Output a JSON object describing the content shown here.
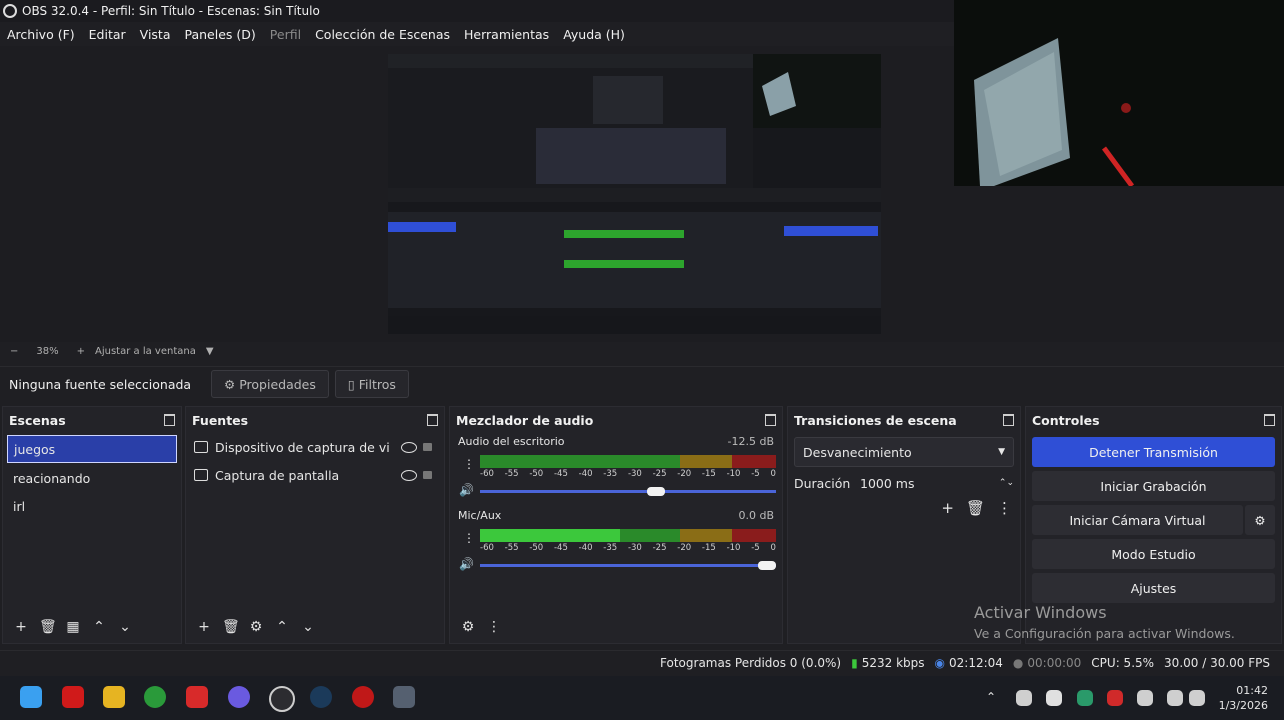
{
  "window": {
    "title": "OBS 32.0.4 - Perfil: Sin Título - Escenas: Sin Título"
  },
  "menu": [
    "Archivo (F)",
    "Editar",
    "Vista",
    "Paneles (D)",
    "Perfil",
    "Colección de Escenas",
    "Herramientas",
    "Ayuda (H)"
  ],
  "zoom": {
    "minus": "−",
    "value": "38%",
    "plus": "+",
    "fit": "Ajustar a la ventana"
  },
  "source_toolbar": {
    "no_source": "Ninguna fuente seleccionada",
    "properties": "Propiedades",
    "filters": "Filtros"
  },
  "scenes": {
    "title": "Escenas",
    "items": [
      "juegos",
      "reacionando",
      "irl"
    ],
    "selected": 0
  },
  "sources": {
    "title": "Fuentes",
    "items": [
      "Dispositivo de captura de video",
      "Captura de pantalla"
    ]
  },
  "mixer": {
    "title": "Mezclador de audio",
    "scale": [
      "-60",
      "-55",
      "-50",
      "-45",
      "-40",
      "-35",
      "-30",
      "-25",
      "-20",
      "-15",
      "-10",
      "-5",
      "0"
    ],
    "channels": [
      {
        "name": "Audio del escritorio",
        "db": "-12.5 dB",
        "level": 0.6
      },
      {
        "name": "Mic/Aux",
        "db": "0.0 dB",
        "level": 1.0
      }
    ]
  },
  "transitions": {
    "title": "Transiciones de escena",
    "selected": "Desvanecimiento",
    "duration_label": "Duración",
    "duration_value": "1000 ms"
  },
  "controls": {
    "title": "Controles",
    "buttons": [
      "Detener Transmisión",
      "Iniciar Grabación",
      "Iniciar Cámara Virtual",
      "Modo Estudio",
      "Ajustes"
    ]
  },
  "status": {
    "dropped": "Fotogramas Perdidos 0 (0.0%)",
    "bitrate": "5232 kbps",
    "stream_time": "02:12:04",
    "rec_time": "00:00:00",
    "cpu": "CPU: 5.5%",
    "fps": "30.00 / 30.00 FPS"
  },
  "watermark": {
    "line1": "Activar Windows",
    "line2": "Ve a Configuración para activar Windows."
  },
  "taskbar": {
    "time": "01:42",
    "date": "1/3/2026"
  },
  "colors": {
    "accent": "#2f4fd6",
    "meter_green": "#3cc83c",
    "meter_yellow": "#c8a020",
    "meter_red": "#c82828"
  }
}
